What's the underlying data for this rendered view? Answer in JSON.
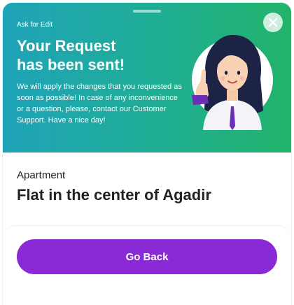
{
  "banner": {
    "eyebrow": "Ask for Edit",
    "headline_line1": "Your Request",
    "headline_line2": "has been sent!",
    "message": "We will apply the changes that you requested as soon as possible! In case of any inconvenience or a question, please, contact our Customer Support. Have a nice day!",
    "close_icon": "close-icon",
    "illustration": "support-agent-thumbs-up-illustration"
  },
  "property": {
    "type": "Apartment",
    "title": "Flat in the center of Agadir"
  },
  "actions": {
    "go_back_label": "Go Back"
  },
  "colors": {
    "banner_gradient_start": "#1fa3b9",
    "banner_gradient_end": "#22b36a",
    "primary_button": "#8a2ad6",
    "text_dark": "#222222"
  }
}
